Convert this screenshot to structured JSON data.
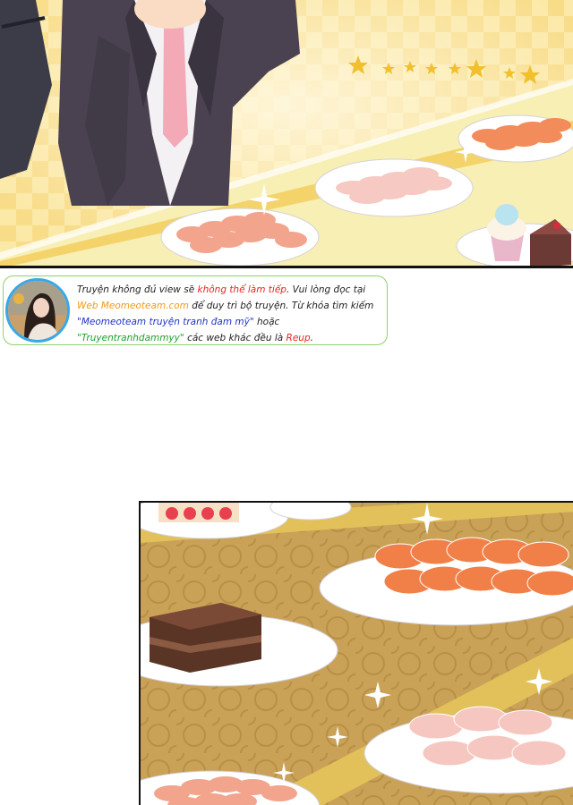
{
  "notice": {
    "line1_a": "Truyện không đủ view sẽ ",
    "line1_b": "không thể làm tiếp",
    "line1_c": ". Vui lòng đọc tại",
    "line2_a": "Web Meomeoteam.com",
    "line2_b": " để duy trì bộ truyện. Từ khóa tìm kiếm",
    "line3_a": "\"Meomeoteam truyện tranh đam mỹ\"",
    "line3_b": " hoặc",
    "line4_a": "\"Truyentranhdammyy\"",
    "line4_b": " các web khác đều là ",
    "line4_c": "Reup",
    "line4_d": "."
  },
  "colors": {
    "warning_red": "#e8231f",
    "site_orange": "#f39a16",
    "keyword_blue": "#2033c4",
    "keyword_green": "#1f9f2a",
    "border_green": "#8fd16a",
    "avatar_ring": "#38a8e8"
  }
}
